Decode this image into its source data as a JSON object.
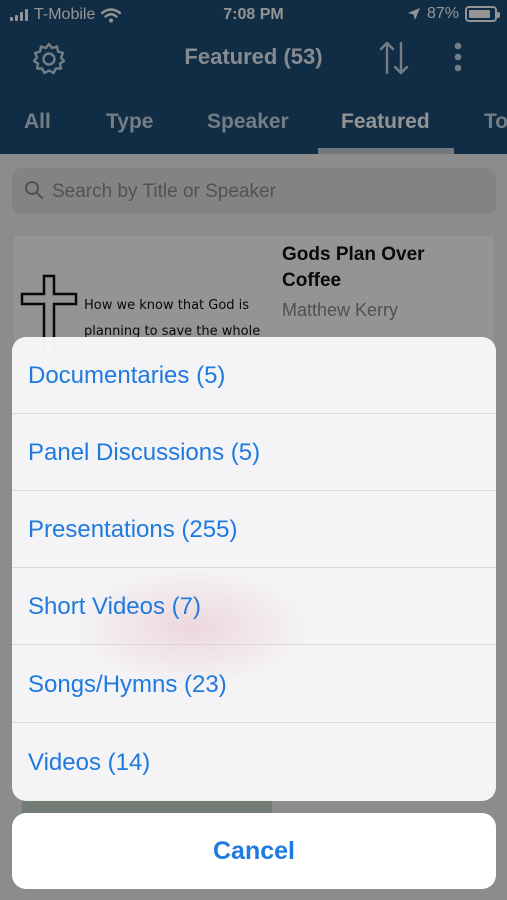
{
  "status_bar": {
    "carrier": "T-Mobile",
    "time": "7:08 PM",
    "battery": "87%",
    "battery_level": 0.87
  },
  "nav": {
    "title": "Featured (53)",
    "left_icon": "gear-icon",
    "right_icons": [
      "sort-icon",
      "more-icon"
    ]
  },
  "tabs": [
    {
      "label": "All"
    },
    {
      "label": "Type"
    },
    {
      "label": "Speaker"
    },
    {
      "label": "Featured",
      "active": true
    },
    {
      "label": "To"
    }
  ],
  "search": {
    "placeholder": "Search by Title or Speaker"
  },
  "card": {
    "title": "Gods Plan Over Coffee",
    "speaker": "Matthew Kerry",
    "thumbnail_lines": [
      "How we know that God is",
      "planning to save the whole"
    ]
  },
  "action_sheet": {
    "options": [
      "Documentaries (5)",
      "Panel Discussions (5)",
      "Presentations (255)",
      "Short Videos (7)",
      "Songs/Hymns (23)",
      "Videos (14)"
    ],
    "cancel": "Cancel"
  },
  "colors": {
    "nav_bg": "#1c4f77",
    "action_text": "#1f7ae0"
  }
}
